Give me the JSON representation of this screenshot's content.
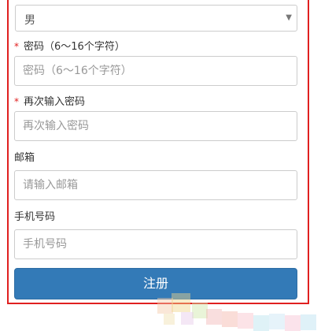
{
  "gender_select": {
    "value": "男",
    "caret": "▼"
  },
  "password": {
    "label": "密码（6～16个字符）",
    "placeholder": "密码（6～16个字符）",
    "required": true
  },
  "password_confirm": {
    "label": "再次输入密码",
    "placeholder": "再次输入密码",
    "required": true
  },
  "email": {
    "label": "邮箱",
    "placeholder": "请输入邮箱"
  },
  "phone": {
    "label": "手机号码",
    "placeholder": "手机号码"
  },
  "submit": {
    "label": "注册"
  },
  "required_marker": "*",
  "colors": {
    "accent": "#337ab7",
    "frame": "#e02020",
    "required": "#e02020",
    "border": "#cccccc"
  }
}
